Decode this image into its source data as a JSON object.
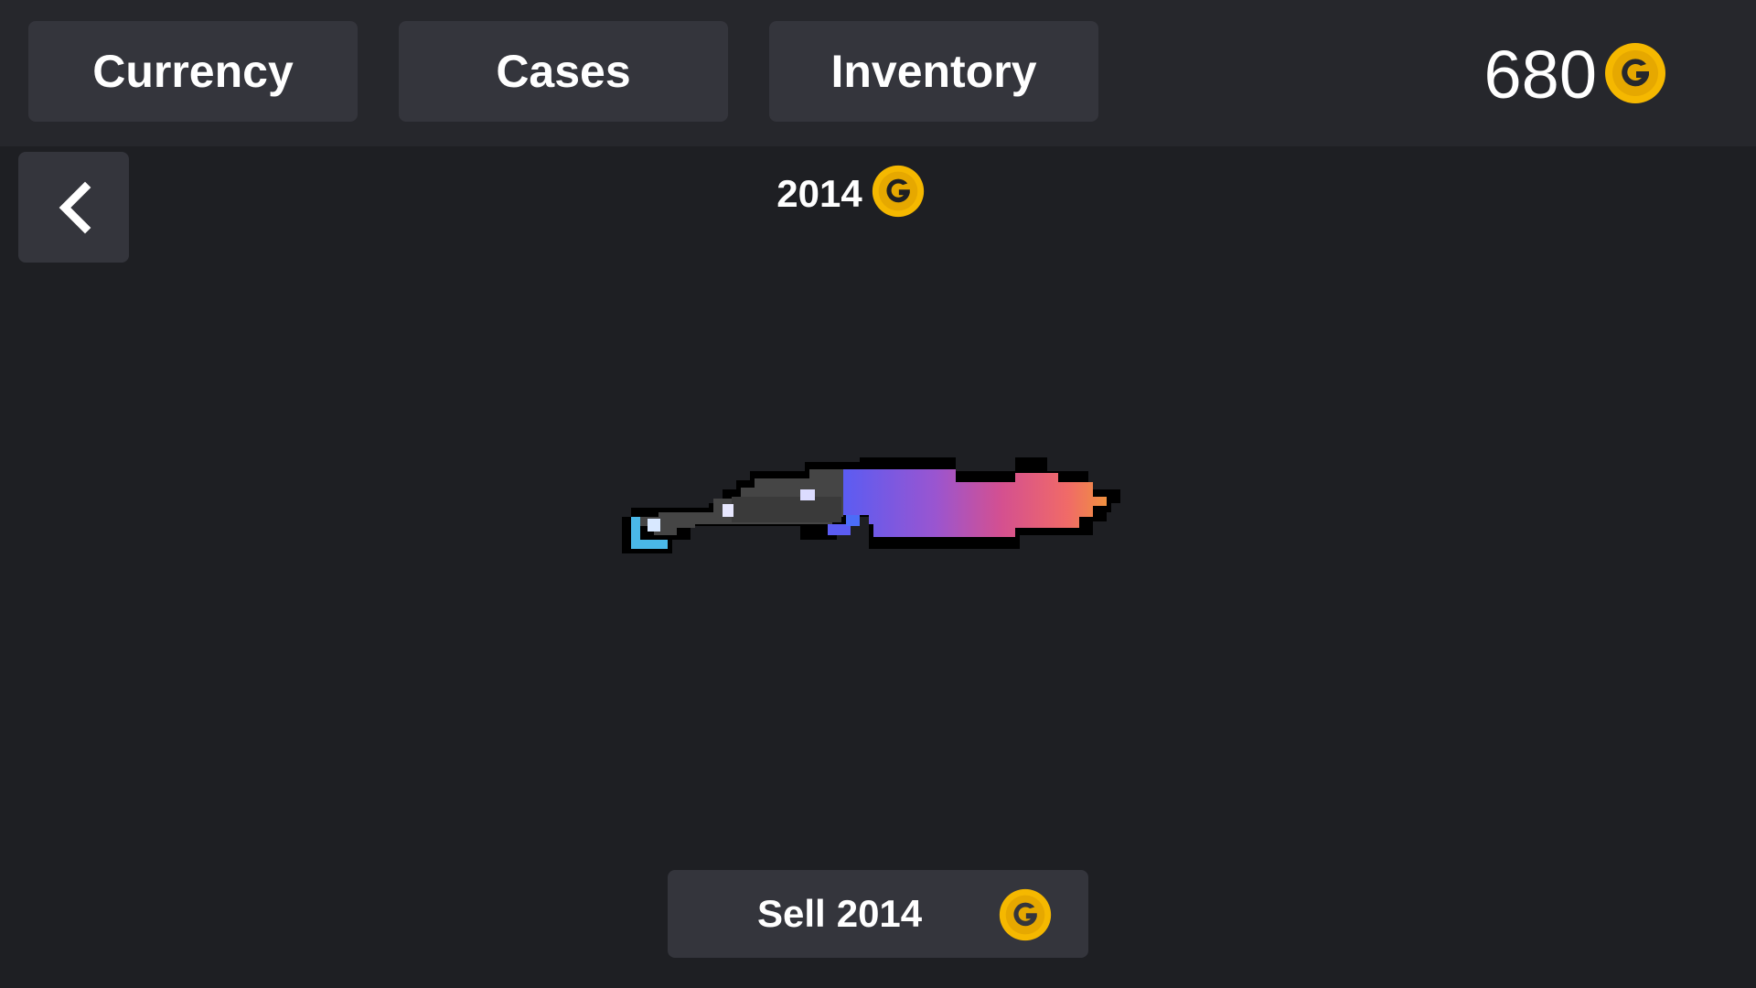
{
  "nav": {
    "tabs": [
      {
        "label": "Currency"
      },
      {
        "label": "Cases"
      },
      {
        "label": "Inventory"
      }
    ]
  },
  "balance": {
    "value": "680",
    "coin_icon": "gold-coin-icon"
  },
  "item": {
    "price": "2014",
    "name_icon": "knife-item-icon",
    "colors": {
      "handle": "#3a3a3a",
      "blade_start": "#5b5cf2",
      "blade_mid": "#c24fb8",
      "blade_end": "#f08040",
      "pommel": "#4ab8e8"
    }
  },
  "sell": {
    "label": "Sell",
    "amount": "2014"
  },
  "colors": {
    "background": "#1e1f23",
    "topbar": "#26272c",
    "button": "#34353c",
    "coin": "#f5b800"
  }
}
